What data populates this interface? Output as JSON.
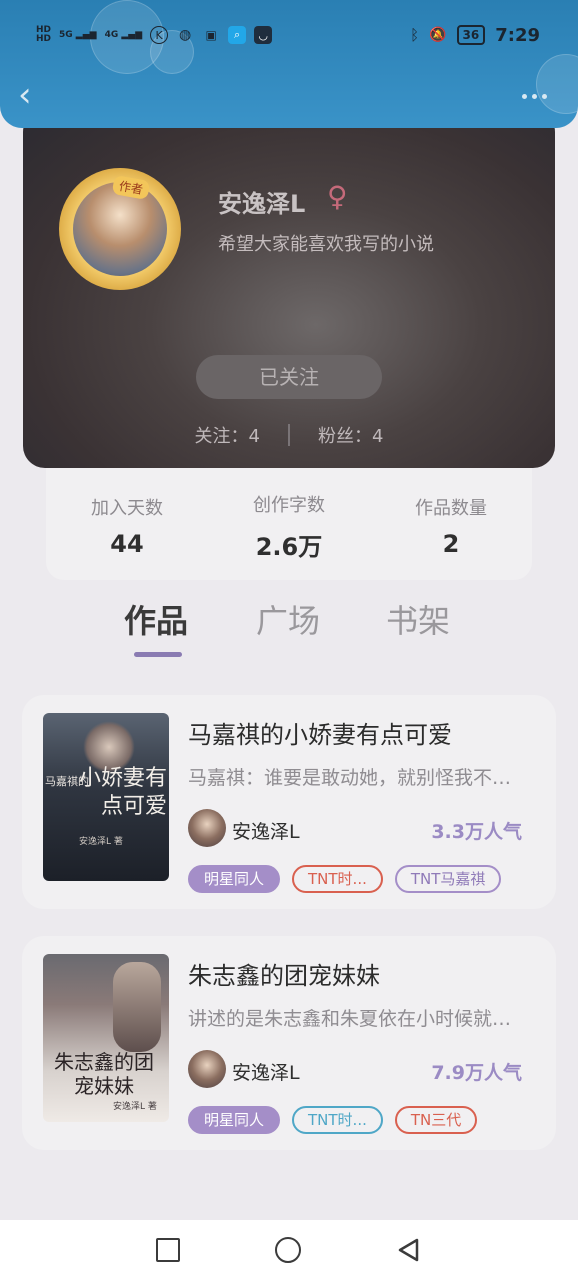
{
  "status": {
    "signals": [
      "HD",
      "HD",
      "5G",
      "4G"
    ],
    "time": "7:29",
    "battery": "36"
  },
  "profile": {
    "author_badge": "作者",
    "name": "安逸泽L",
    "gender_symbol": "♀",
    "bio": "希望大家能喜欢我写的小说",
    "follow_label": "已关注",
    "following_label": "关注：4",
    "followers_label": "粉丝：4"
  },
  "stats": [
    {
      "label": "加入天数",
      "value": "44"
    },
    {
      "label": "创作字数",
      "value": "2.6万"
    },
    {
      "label": "作品数量",
      "value": "2"
    }
  ],
  "tabs": [
    {
      "label": "作品",
      "active": true
    },
    {
      "label": "广场",
      "active": false
    },
    {
      "label": "书架",
      "active": false
    }
  ],
  "books": [
    {
      "title": "马嘉祺的小娇妻有点可爱",
      "description": "马嘉祺：谁要是敢动她，就别怪我不客气",
      "author": "安逸泽L",
      "popularity": "3.3万人气",
      "cover_text_small": "马嘉祺的",
      "cover_text": "小娇妻有点可爱",
      "cover_author": "安逸泽L 著",
      "tags": [
        {
          "label": "明星同人",
          "style": "filled-purple"
        },
        {
          "label": "TNT时...",
          "style": "outline-red"
        },
        {
          "label": "TNT马嘉祺",
          "style": "outline-purple"
        }
      ]
    },
    {
      "title": "朱志鑫的团宠妹妹",
      "description": "讲述的是朱志鑫和朱夏依在小时候就分开了",
      "author": "安逸泽L",
      "popularity": "7.9万人气",
      "cover_text": "朱志鑫的团宠妹妹",
      "cover_author": "安逸泽L 著",
      "tags": [
        {
          "label": "明星同人",
          "style": "filled-purple"
        },
        {
          "label": "TNT时...",
          "style": "outline-blue"
        },
        {
          "label": "TN三代",
          "style": "outline-red"
        }
      ]
    }
  ],
  "colors": {
    "header": "#2a7fb3",
    "accent_purple": "#9b8bc4",
    "tag_red": "#d9604f",
    "tag_blue": "#4fa7c7"
  }
}
